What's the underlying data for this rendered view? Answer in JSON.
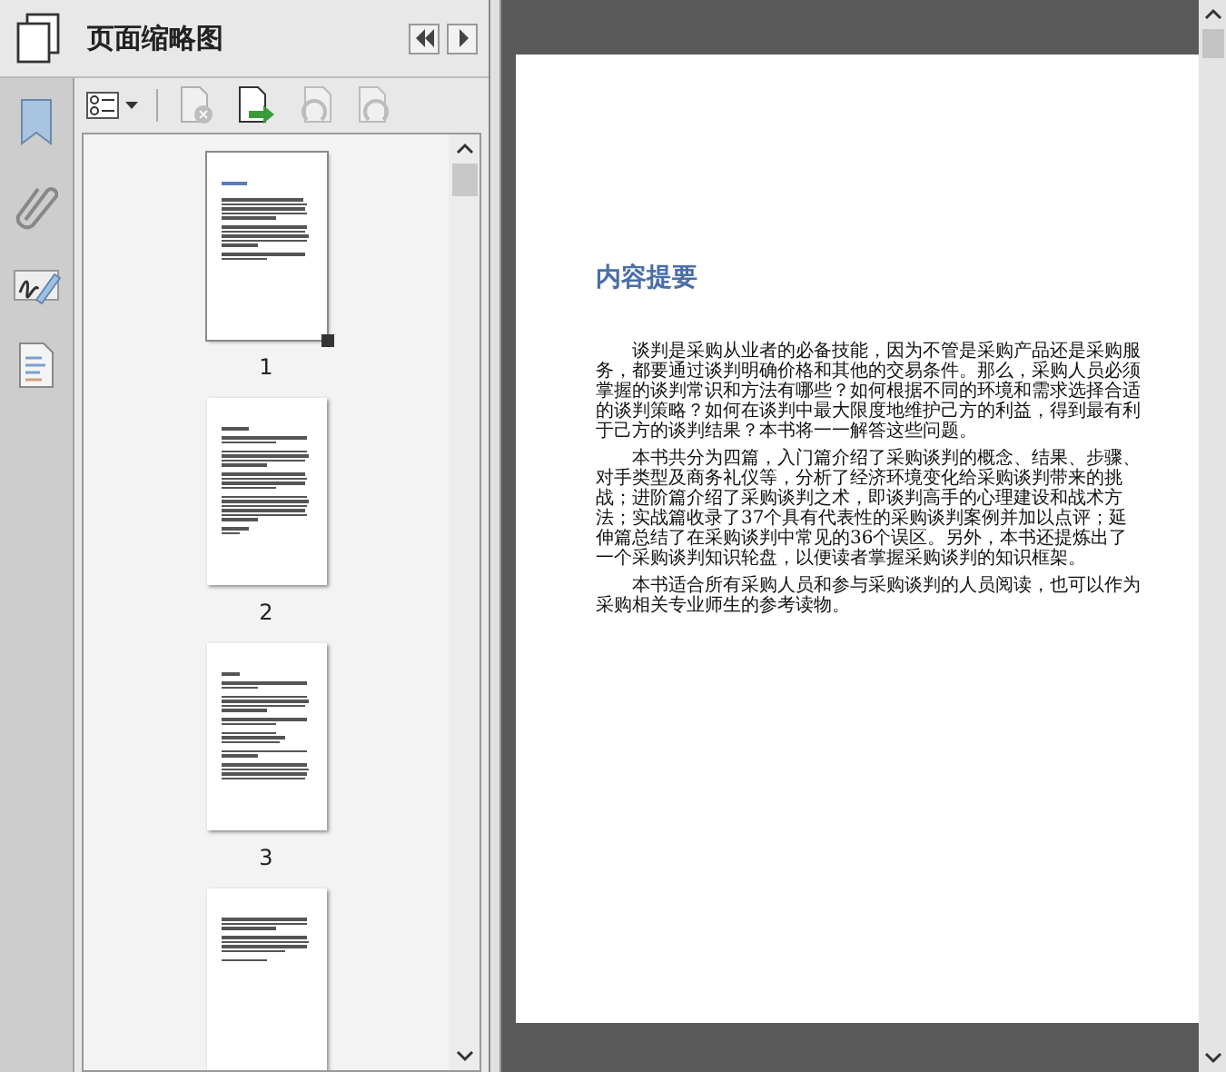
{
  "panel": {
    "title": "页面缩略图"
  },
  "thumbnails": [
    {
      "number": "1",
      "selected": true
    },
    {
      "number": "2",
      "selected": false
    },
    {
      "number": "3",
      "selected": false
    },
    {
      "selected": false
    }
  ],
  "page": {
    "heading": "内容提要",
    "paragraphs": [
      "谈判是采购从业者的必备技能，因为不管是采购产品还是采购服务，都要通过谈判明确价格和其他的交易条件。那么，采购人员必须掌握的谈判常识和方法有哪些？如何根据不同的环境和需求选择合适的谈判策略？如何在谈判中最大限度地维护己方的利益，得到最有利于己方的谈判结果？本书将一一解答这些问题。",
      "本书共分为四篇，入门篇介绍了采购谈判的概念、结果、步骤、对手类型及商务礼仪等，分析了经济环境变化给采购谈判带来的挑战；进阶篇介绍了采购谈判之术，即谈判高手的心理建设和战术方法；实战篇收录了37个具有代表性的采购谈判案例并加以点评；延伸篇总结了在采购谈判中常见的36个误区。另外，本书还提炼出了一个采购谈判知识轮盘，以便读者掌握采购谈判的知识框架。",
      "本书适合所有采购人员和参与采购谈判的人员阅读，也可以作为采购相关专业师生的参考读物。"
    ]
  }
}
